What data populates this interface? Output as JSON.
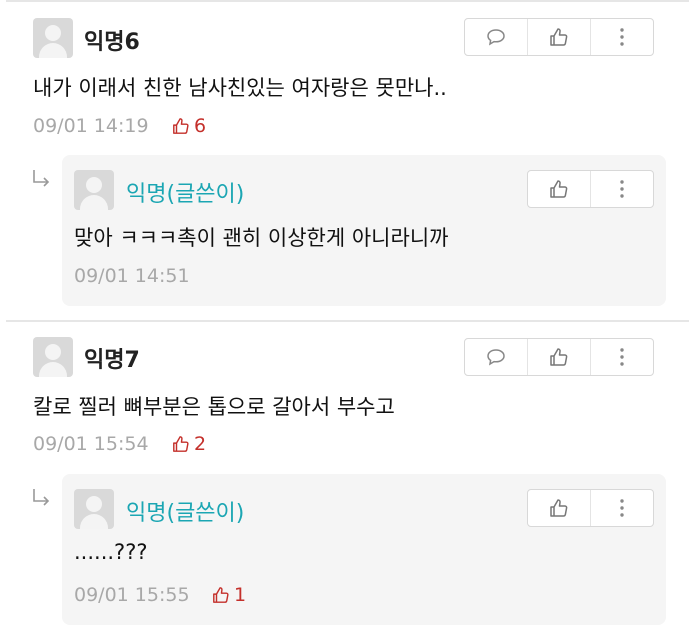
{
  "comments": [
    {
      "nick": "익명6",
      "text": "내가 이래서 친한 남사친있는 여자랑은 못만나..",
      "time": "09/01 14:19",
      "likes": "6"
    },
    {
      "nick": "익명7",
      "text": "칼로 찔러 뼈부분은 톱으로 갈아서 부수고",
      "time": "09/01 15:54",
      "likes": "2"
    }
  ],
  "replies": [
    {
      "nick": "익명(글쓴이)",
      "text": "맞아 ㅋㅋㅋ촉이 괜히 이상한게 아니라니까",
      "time": "09/01 14:51"
    },
    {
      "nick": "익명(글쓴이)",
      "text": "......???",
      "time": "09/01 15:55",
      "likes": "1"
    }
  ],
  "icons": {
    "reply": "speech-bubble",
    "like": "thumbs-up",
    "more": "vertical-dots",
    "reply_indicator": "reply-arrow"
  },
  "colors": {
    "writer_nick": "#1ba6b3",
    "likes": "#c4302b",
    "meta": "#a8a8a8"
  }
}
